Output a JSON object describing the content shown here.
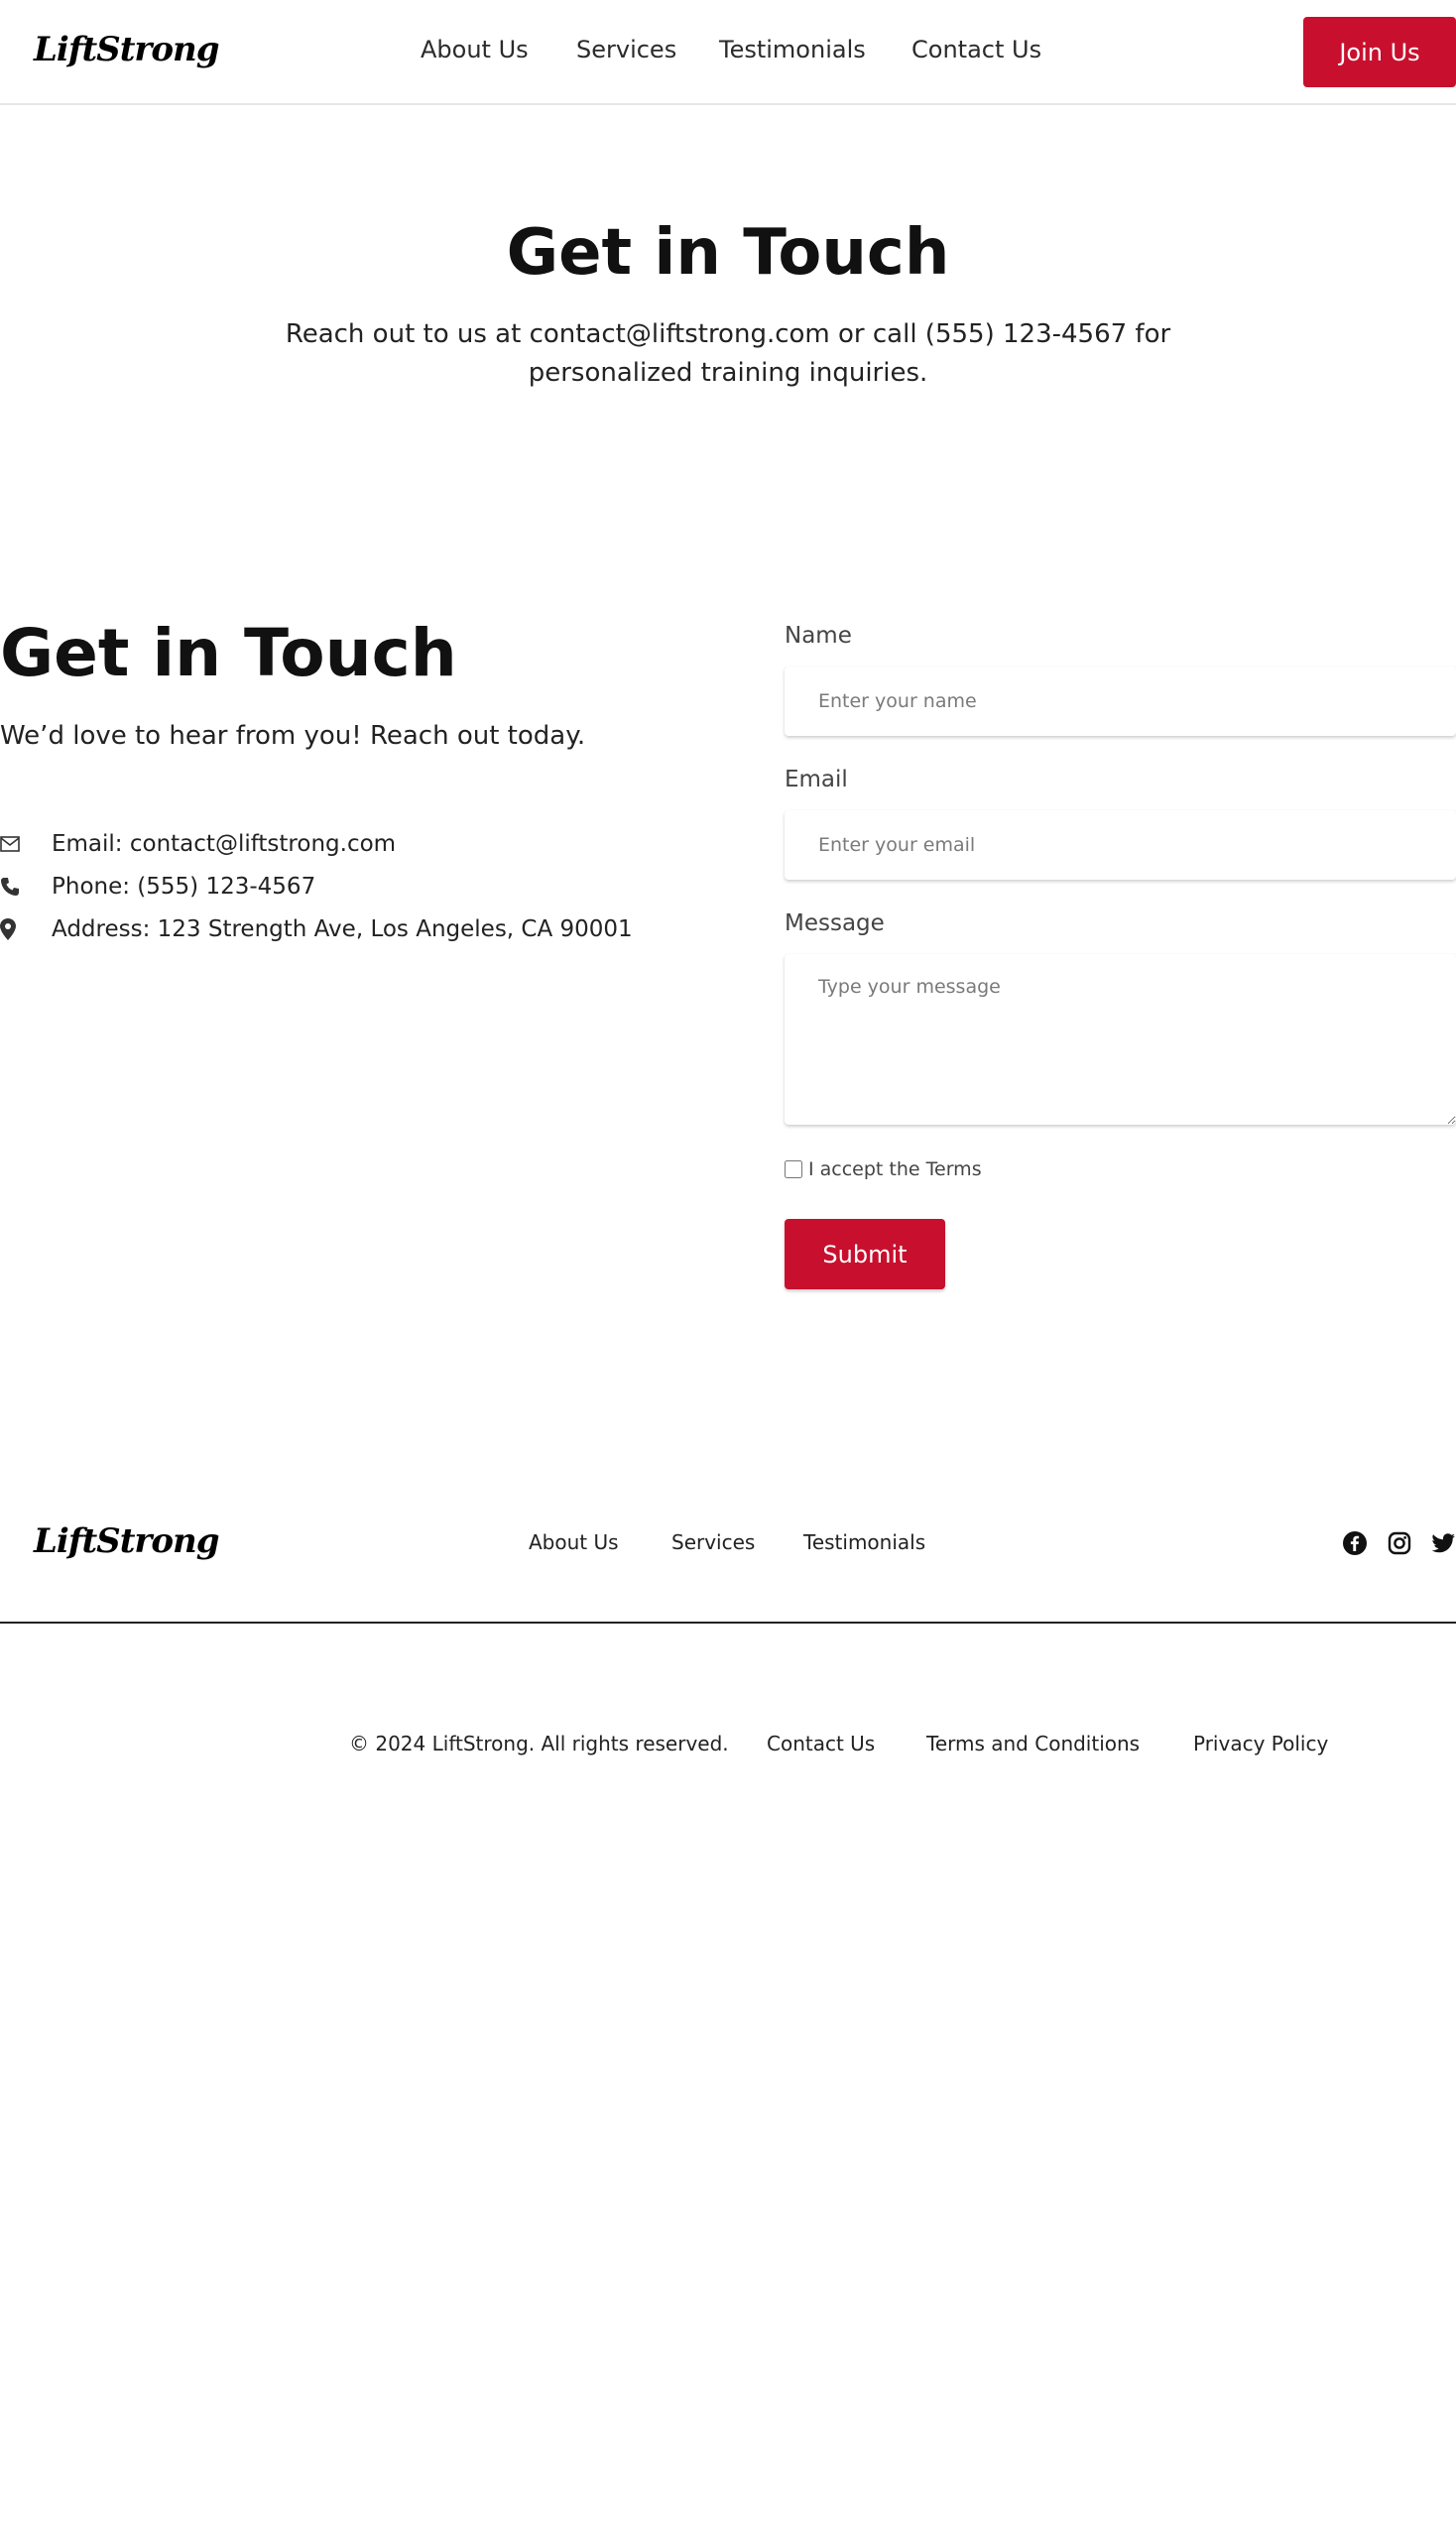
{
  "brand": {
    "logo": "LiftStrong",
    "accent_color": "#c8102e"
  },
  "header": {
    "nav": [
      "About Us",
      "Services",
      "Testimonials",
      "Contact Us"
    ],
    "cta": "Join Us"
  },
  "hero": {
    "title": "Get in Touch",
    "subtitle": "Reach out to us at contact@liftstrong.com or call (555) 123-4567 for personalized training inquiries."
  },
  "contact": {
    "title": "Get in Touch",
    "subtitle": "We’d love to hear from you! Reach out today.",
    "info": [
      {
        "icon": "envelope-icon",
        "text": "Email: contact@liftstrong.com"
      },
      {
        "icon": "phone-icon",
        "text": "Phone: (555) 123-4567"
      },
      {
        "icon": "map-pin-icon",
        "text": "Address: 123 Strength Ave, Los Angeles, CA 90001"
      }
    ]
  },
  "form": {
    "name_label": "Name",
    "name_placeholder": "Enter your name",
    "email_label": "Email",
    "email_placeholder": "Enter your email",
    "message_label": "Message",
    "message_placeholder": "Type your message",
    "terms_label": "I accept the Terms",
    "submit": "Submit"
  },
  "footer": {
    "logo": "LiftStrong",
    "nav": [
      "About Us",
      "Services",
      "Testimonials"
    ],
    "social": [
      "facebook-icon",
      "instagram-icon",
      "twitter-icon"
    ],
    "copyright": "© 2024 LiftStrong. All rights reserved.",
    "bottom_links": [
      "Contact Us",
      "Terms and Conditions",
      "Privacy Policy"
    ]
  }
}
